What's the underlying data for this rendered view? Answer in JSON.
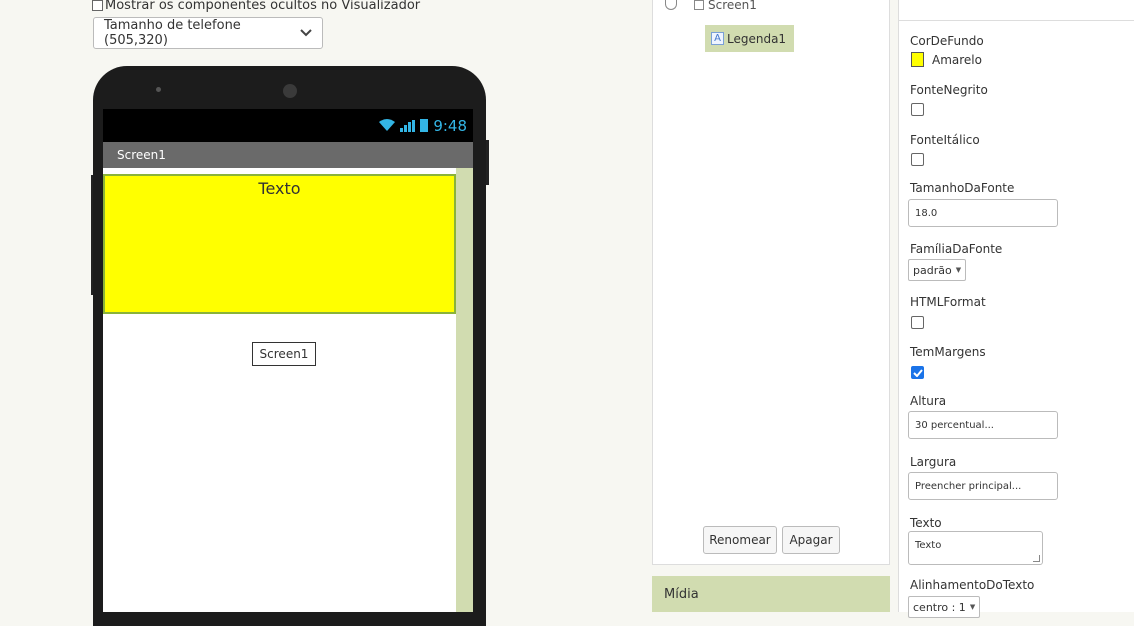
{
  "viewer": {
    "show_hidden_label": "Mostrar os componentes ocultos no Visualizador",
    "phone_size_select": "Tamanho de telefone (505,320)",
    "status_time": "9:48",
    "screen_title": "Screen1",
    "label_text": "Texto",
    "screen_tag": "Screen1"
  },
  "components": {
    "tree_root": "Screen1",
    "tree_item": "Legenda1",
    "rename_button": "Renomear",
    "delete_button": "Apagar",
    "media_header": "Mídia"
  },
  "properties": {
    "bg_color_label": "CorDeFundo",
    "bg_color_value": "Amarelo",
    "bg_color_hex": "#ffff00",
    "bold_label": "FonteNegrito",
    "bold_checked": false,
    "italic_label": "FonteItálico",
    "italic_checked": false,
    "font_size_label": "TamanhoDaFonte",
    "font_size_value": "18.0",
    "font_family_label": "FamíliaDaFonte",
    "font_family_value": "padrão",
    "html_format_label": "HTMLFormat",
    "html_format_checked": false,
    "margins_label": "TemMargens",
    "margins_checked": true,
    "height_label": "Altura",
    "height_value": "30 percentual...",
    "width_label": "Largura",
    "width_value": "Preencher principal...",
    "text_label": "Texto",
    "text_value": "Texto",
    "text_align_label": "AlinhamentoDoTexto",
    "text_align_value": "centro : 1"
  },
  "colors": {
    "accent_green": "#d1dcb0",
    "label_yellow": "#ffff00",
    "checkbox_blue": "#1a73e8",
    "status_blue": "#33b5e5"
  }
}
